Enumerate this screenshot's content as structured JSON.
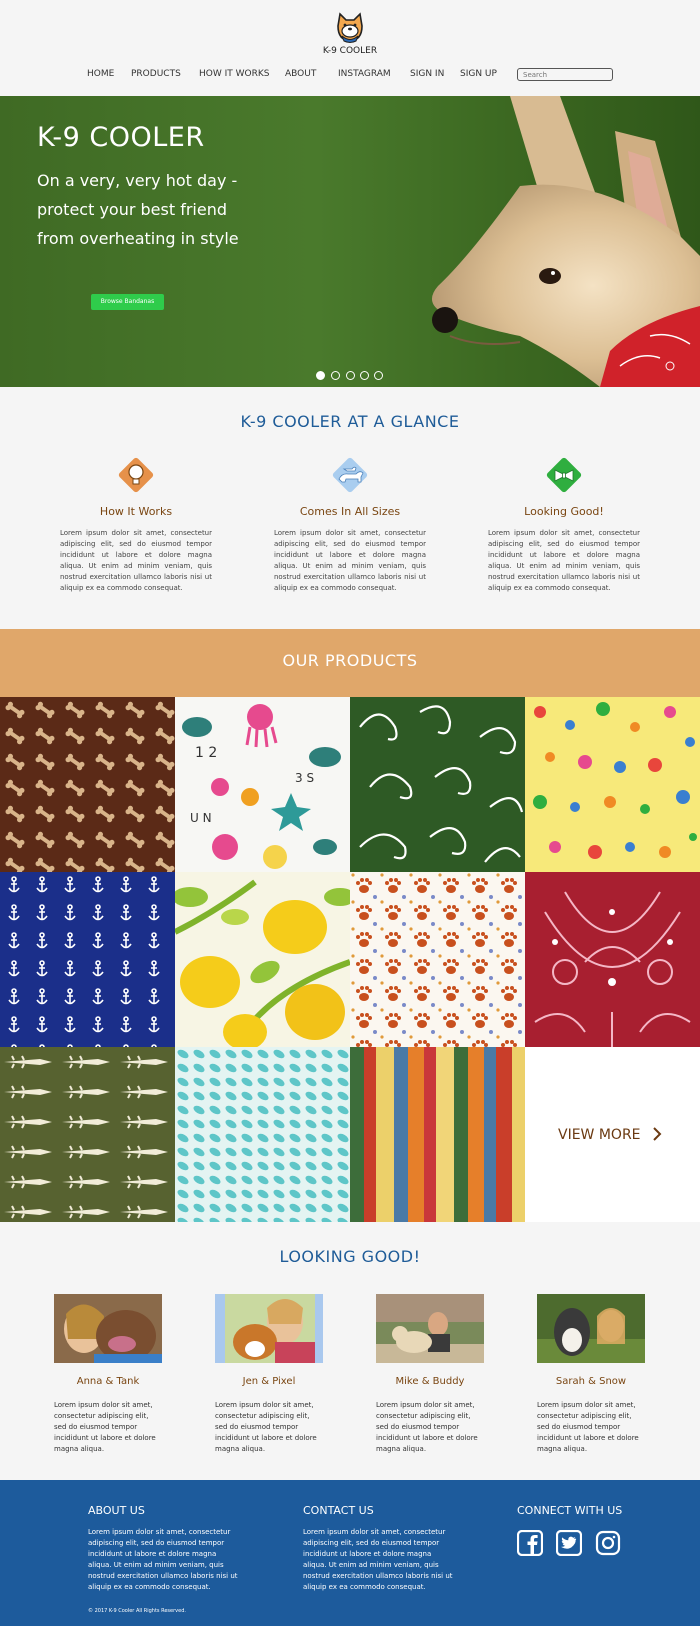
{
  "brand": {
    "name": "K-9 COOLER"
  },
  "nav": {
    "items": [
      "HOME",
      "PRODUCTS",
      "HOW IT WORKS",
      "ABOUT",
      "INSTAGRAM",
      "SIGN IN",
      "SIGN UP"
    ],
    "search_placeholder": "Search"
  },
  "hero": {
    "title": "K-9 COOLER",
    "tagline": "On a very, very hot day - protect your best friend from overheating in style",
    "button": "Browse Bandanas",
    "slides": 5,
    "active_slide": 1
  },
  "glance": {
    "title": "K-9 COOLER AT A GLANCE",
    "features": [
      {
        "icon": "lightbulb-icon",
        "title": "How It Works",
        "text": "Lorem ipsum dolor sit amet, consectetur adipiscing elit, sed do eiusmod tempor incididunt ut labore et dolore magna aliqua. Ut enim ad minim veniam, quis nostrud exercitation ullamco laboris nisi ut aliquip ex ea commodo consequat."
      },
      {
        "icon": "dog-sizes-icon",
        "title": "Comes In All Sizes",
        "text": "Lorem ipsum dolor sit amet, consectetur adipiscing elit, sed do eiusmod tempor incididunt ut labore et dolore magna aliqua. Ut enim ad minim veniam, quis nostrud exercitation ullamco laboris nisi ut aliquip ex ea commodo consequat."
      },
      {
        "icon": "bowtie-icon",
        "title": "Looking Good!",
        "text": "Lorem ipsum dolor sit amet, consectetur adipiscing elit, sed do eiusmod tempor incididunt ut labore et dolore magna aliqua. Ut enim ad minim veniam, quis nostrud exercitation ullamco laboris nisi ut aliquip ex ea commodo consequat."
      }
    ]
  },
  "products": {
    "title": "OUR PRODUCTS",
    "view_more": "VIEW MORE",
    "patterns": [
      "dog-bones",
      "sea-creatures",
      "green-swirls",
      "polka-dots",
      "navy-anchors",
      "lemons",
      "paw-prints",
      "red-paisley",
      "alligators",
      "teal-leaves",
      "vertical-stripes"
    ]
  },
  "looking_good": {
    "title": "LOOKING GOOD!",
    "people": [
      {
        "name": "Anna & Tank",
        "text": "Lorem ipsum dolor sit amet, consectetur adipiscing elit, sed do eiusmod tempor incididunt ut labore et dolore magna aliqua."
      },
      {
        "name": "Jen & Pixel",
        "text": "Lorem ipsum dolor sit amet, consectetur adipiscing elit, sed do eiusmod tempor incididunt ut labore et dolore magna aliqua."
      },
      {
        "name": "Mike & Buddy",
        "text": "Lorem ipsum dolor sit amet, consectetur adipiscing elit, sed do eiusmod tempor incididunt ut labore et dolore magna aliqua."
      },
      {
        "name": "Sarah & Snow",
        "text": "Lorem ipsum dolor sit amet, consectetur adipiscing elit, sed do eiusmod tempor incididunt ut labore et dolore magna aliqua."
      }
    ]
  },
  "footer": {
    "about_title": "ABOUT US",
    "about_text": "Lorem ipsum dolor sit amet, consectetur adipiscing elit, sed do eiusmod tempor incididunt ut labore et dolore magna aliqua. Ut enim ad minim veniam, quis nostrud exercitation ullamco laboris nisi ut aliquip ex ea commodo consequat.",
    "contact_title": "CONTACT US",
    "contact_text": "Lorem ipsum dolor sit amet, consectetur adipiscing elit, sed do eiusmod tempor incididunt ut labore et dolore magna aliqua. Ut enim ad minim veniam, quis nostrud exercitation ullamco laboris nisi ut aliquip ex ea commodo consequat.",
    "connect_title": "CONNECT WITH US",
    "copyright": "©  2017 K-9 Cooler All Rights Reserved.",
    "social": [
      "facebook-icon",
      "twitter-icon",
      "instagram-icon"
    ]
  },
  "colors": {
    "accent_blue": "#1f5c98",
    "footer_blue": "#1d5b9c",
    "products_band": "#e0a76a",
    "cta_green": "#2fcc4b",
    "heading_brown": "#7a4612"
  }
}
